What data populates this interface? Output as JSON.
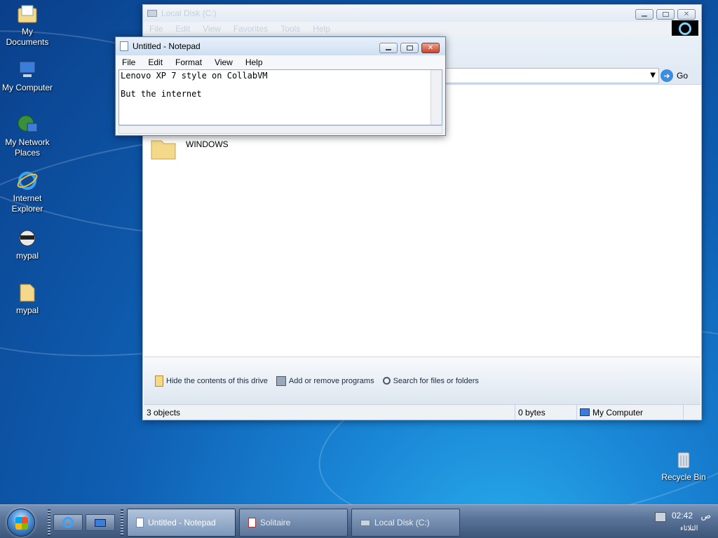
{
  "desktop": {
    "icons": [
      {
        "label": "My Documents"
      },
      {
        "label": "My Computer"
      },
      {
        "label": "My Network Places"
      },
      {
        "label": "Internet Explorer"
      },
      {
        "label": "mypal"
      },
      {
        "label": "mypal"
      },
      {
        "label": "Recycle Bin"
      }
    ]
  },
  "explorer": {
    "title": "Local Disk (C:)",
    "menu": [
      "File",
      "Edit",
      "View",
      "Favorites",
      "Tools",
      "Help"
    ],
    "go_label": "Go",
    "items": [
      {
        "label": "WINDOWS"
      }
    ],
    "tasks": [
      {
        "label": "Hide the contents of this drive",
        "icon": "folder-icon"
      },
      {
        "label": "Add or remove programs",
        "icon": "programs-icon"
      },
      {
        "label": "Search for files or folders",
        "icon": "search-icon"
      }
    ],
    "status": {
      "objects": "3 objects",
      "size": "0 bytes",
      "location": "My Computer"
    }
  },
  "notepad": {
    "title": "Untitled - Notepad",
    "menu": [
      "File",
      "Edit",
      "Format",
      "View",
      "Help"
    ],
    "lines": [
      "Lenovo XP 7 style on CollabVM",
      "",
      "But the internet"
    ]
  },
  "taskbar": {
    "buttons": [
      {
        "label": "Untitled - Notepad",
        "active": true
      },
      {
        "label": "Solitaire",
        "active": false
      },
      {
        "label": "Local Disk (C:)",
        "active": false
      }
    ],
    "clock": {
      "time": "02:42",
      "ampm": "ص",
      "day": "الثلاثاء"
    }
  },
  "colors": {
    "accent": "#1a86d6",
    "close_red": "#c7452b"
  }
}
